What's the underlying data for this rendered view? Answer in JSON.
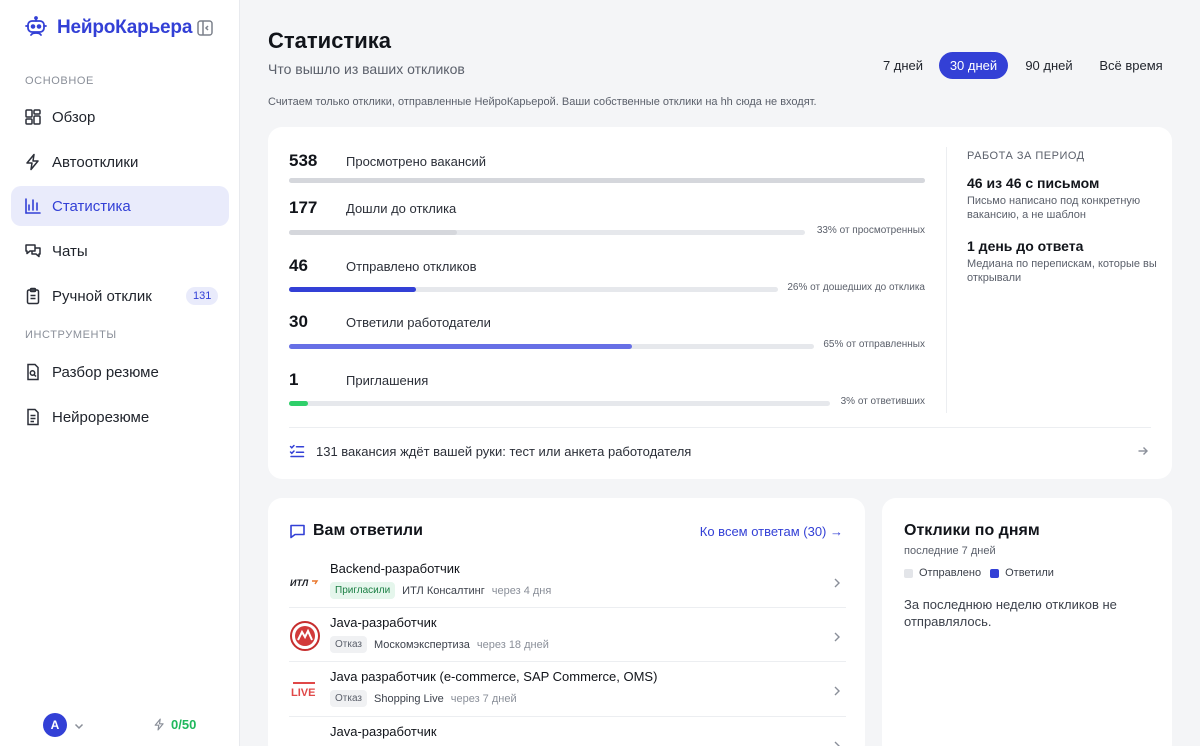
{
  "brand": {
    "name": "НейроКарьера"
  },
  "sidebar": {
    "section_main": "ОСНОВНОЕ",
    "section_tools": "ИНСТРУМЕНТЫ",
    "items": [
      {
        "label": "Обзор",
        "icon": "grid-icon"
      },
      {
        "label": "Автоотклики",
        "icon": "lightning-icon"
      },
      {
        "label": "Статистика",
        "icon": "bar-chart-icon",
        "active": true
      },
      {
        "label": "Чаты",
        "icon": "chat-icon"
      },
      {
        "label": "Ручной отклик",
        "icon": "clipboard-icon",
        "badge": "131"
      }
    ],
    "tools": [
      {
        "label": "Разбор резюме",
        "icon": "doc-search-icon"
      },
      {
        "label": "Нейрорезюме",
        "icon": "doc-icon"
      }
    ],
    "user_initial": "A",
    "quota": "0/50"
  },
  "header": {
    "title": "Статистика",
    "subtitle": "Что вышло из ваших откликов",
    "note": "Считаем только отклики, отправленные НейроКарьерой. Ваши собственные отклики на hh сюда не входят.",
    "periods": [
      "7 дней",
      "30 дней",
      "90 дней",
      "Всё время"
    ],
    "active_period": "30 дней"
  },
  "funnel": {
    "rows": [
      {
        "value": "538",
        "label": "Просмотрено вакансий",
        "fraction": 1.0,
        "pct": "",
        "color": "#d5d7dc"
      },
      {
        "value": "177",
        "label": "Дошли до отклика",
        "fraction": 0.33,
        "pct": "33% от просмотренных",
        "color": "#d5d7dc"
      },
      {
        "value": "46",
        "label": "Отправлено откликов",
        "fraction": 0.26,
        "pct": "26% от дошедших до отклика",
        "color": "#3340d6"
      },
      {
        "value": "30",
        "label": "Ответили работодатели",
        "fraction": 0.65,
        "pct": "65% от отправленных",
        "color": "#6770e6"
      },
      {
        "value": "1",
        "label": "Приглашения",
        "fraction": 0.03,
        "pct": "3% от ответивших",
        "color": "#2fcf6a"
      }
    ],
    "work": {
      "heading": "РАБОТА ЗА ПЕРИОД",
      "stat1_big": "46 из 46 с письмом",
      "stat1_small": "Письмо написано под конкретную вакансию, а не шаблон",
      "stat2_big": "1 день до ответа",
      "stat2_small": "Медиана по перепискам, которые вы открывали"
    },
    "manual_note": "131 вакансия ждёт вашей руки: тест или анкета работодателя"
  },
  "replies": {
    "title": "Вам ответили",
    "link": "Ко всем ответам (30) →",
    "items": [
      {
        "title": "Backend-разработчик",
        "tag": "Пригласили",
        "tag_type": "invite",
        "company": "ИТЛ Консалтинг",
        "when": "через 4 дня",
        "logo_text": "ИТЛ"
      },
      {
        "title": "Java-разработчик",
        "tag": "Отказ",
        "tag_type": "reject",
        "company": "Москомэкспертиза",
        "when": "через 18 дней",
        "logo_text": ""
      },
      {
        "title": "Java разработчик (e-commerce, SAP Commerce, OMS)",
        "tag": "Отказ",
        "tag_type": "reject",
        "company": "Shopping Live",
        "when": "через 7 дней",
        "logo_text": "LIVE"
      },
      {
        "title": "Java-разработчик",
        "tag": "",
        "tag_type": "reject",
        "company": "",
        "when": "",
        "logo_text": ""
      }
    ]
  },
  "by_days": {
    "title": "Отклики по дням",
    "subtitle": "последние 7 дней",
    "legend_sent": "Отправлено",
    "legend_replied": "Ответили",
    "empty": "За последнюю неделю откликов не отправлялось.",
    "color_sent": "#e3e5e9",
    "color_replied": "#3340d6"
  }
}
